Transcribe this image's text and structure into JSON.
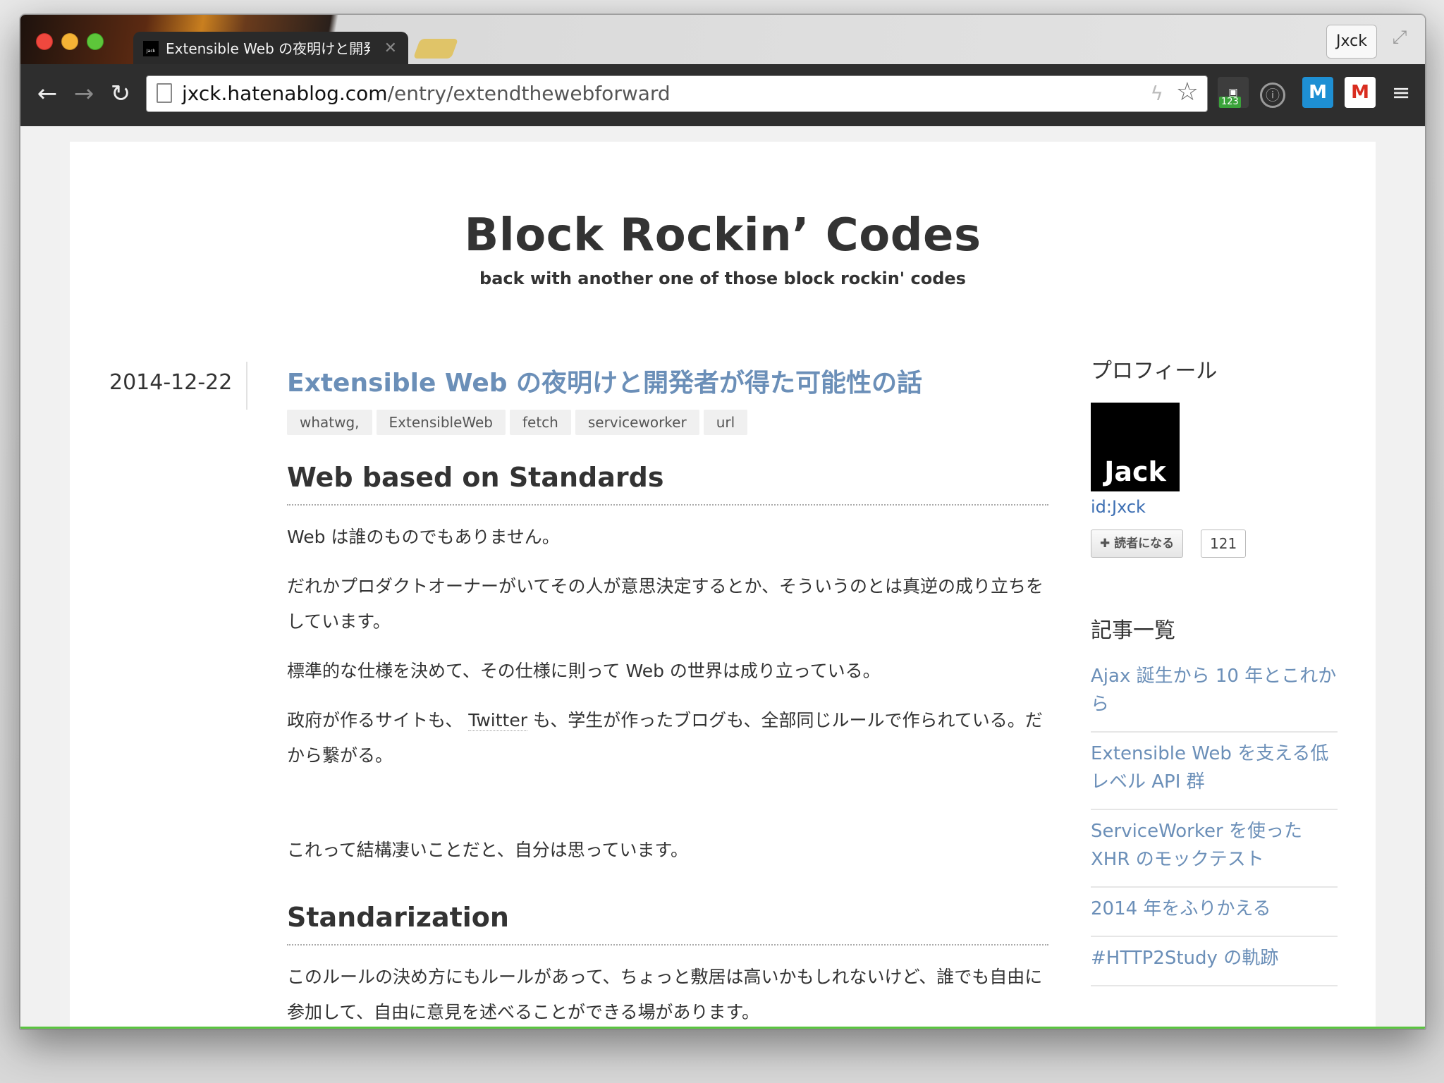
{
  "browser": {
    "tab_title": "Extensible Web の夜明けと開発者が得た可能性の話",
    "tab_favicon_text": "Jack",
    "profile_name": "Jxck",
    "url_domain": "jxck.hatenablog.com",
    "url_path": "/entry/extendthewebforward",
    "extension_badge": "123",
    "icons": [
      "back-arrow-icon",
      "forward-arrow-icon",
      "reload-icon",
      "page-icon",
      "bolt-icon",
      "star-icon",
      "extension-icon",
      "1password-icon",
      "m-icon",
      "gmail-icon",
      "menu-icon"
    ]
  },
  "blog": {
    "title": "Block Rockin’ Codes",
    "description": "back with another one of those block rockin' codes"
  },
  "entry": {
    "date": "2014-12-22",
    "title": "Extensible Web の夜明けと開発者が得た可能性の話",
    "categories": [
      "whatwg,",
      "ExtensibleWeb",
      "fetch",
      "serviceworker",
      "url"
    ],
    "section1_heading": "Web based on Standards",
    "p1": "Web は誰のものでもありません。",
    "p2": "だれかプロダクトオーナーがいてその人が意思決定するとか、そういうのとは真逆の成り立ちをしています。",
    "p3": "標準的な仕様を決めて、その仕様に則って Web の世界は成り立っている。",
    "p4_before": "政府が作るサイトも、",
    "p4_link": "Twitter",
    "p4_after": "も、学生が作ったブログも、全部同じルールで作られている。だから繋がる。",
    "p5": "これって結構凄いことだと、自分は思っています。",
    "section2_heading": "Standarization",
    "p6": "このルールの決め方にもルールがあって、ちょっと敷居は高いかもしれないけど、誰でも自由に参加して、自由に意見を述べることができる場があります。"
  },
  "sidebar": {
    "profile_heading": "プロフィール",
    "avatar_text": "Jack",
    "user_id": "id:Jxck",
    "subscribe_label": "読者になる",
    "subscriber_count": "121",
    "articles_heading": "記事一覧",
    "articles": [
      "Ajax 誕生から 10 年とこれから",
      "Extensible Web を支える低レベル API 群",
      "ServiceWorker を使った XHR のモックテスト",
      "2014 年をふりかえる",
      "#HTTP2Study の軌跡"
    ]
  }
}
